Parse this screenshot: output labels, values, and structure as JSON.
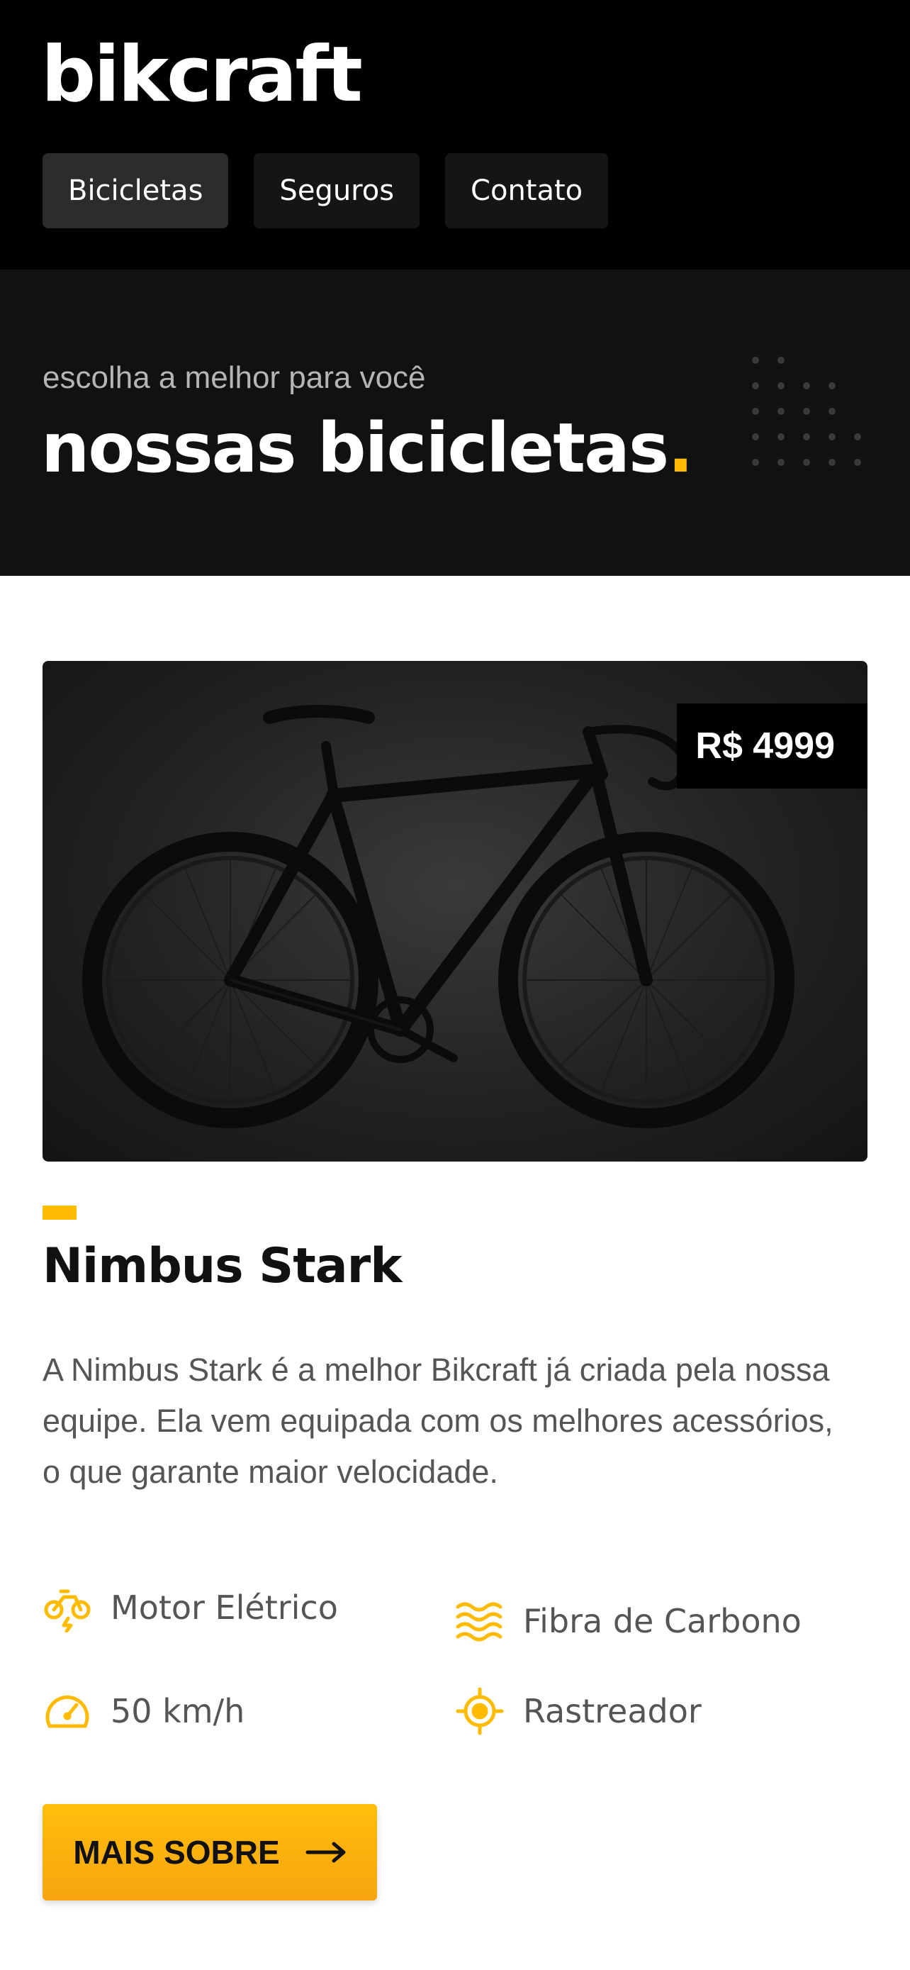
{
  "header": {
    "logo": "bikcraft",
    "nav": [
      {
        "label": "Bicicletas",
        "active": true
      },
      {
        "label": "Seguros",
        "active": false
      },
      {
        "label": "Contato",
        "active": false
      }
    ]
  },
  "hero": {
    "subtitle": "escolha a melhor para você",
    "title": "nossas bicicletas",
    "title_dot": "."
  },
  "product": {
    "price": "R$ 4999",
    "name": "Nimbus Stark",
    "description": "A Nimbus Stark é a melhor Bikcraft já criada pela nossa equipe. Ela vem equipada com os melhores acessórios, o que garante maior velocidade.",
    "features": [
      {
        "icon": "electric-bike-icon",
        "label": "Motor Elétrico"
      },
      {
        "icon": "carbon-fiber-icon",
        "label": "Fibra de Carbono"
      },
      {
        "icon": "speedometer-icon",
        "label": "50 km/h"
      },
      {
        "icon": "tracker-icon",
        "label": "Rastreador"
      }
    ],
    "cta_label": "MAIS SOBRE",
    "cta_icon": "arrow-right-icon"
  },
  "colors": {
    "accent": "#ffbb00",
    "header_bg": "#000000",
    "hero_bg": "#111111"
  }
}
